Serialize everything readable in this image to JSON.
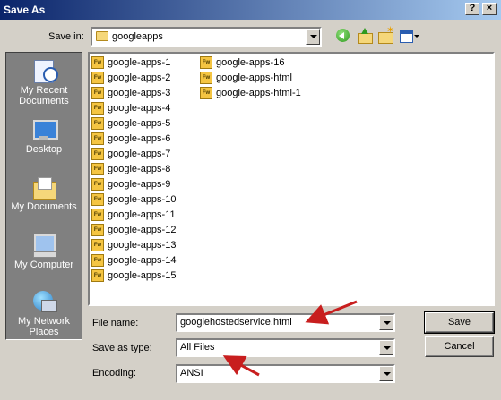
{
  "window": {
    "title": "Save As",
    "help_glyph": "?",
    "close_glyph": "×"
  },
  "toolbar": {
    "save_in_label": "Save in:",
    "save_in_value": "googleapps",
    "icons": [
      "back-icon",
      "up-folder-icon",
      "new-folder-icon",
      "views-menu-icon"
    ]
  },
  "places": [
    {
      "label": "My Recent Documents",
      "icon": "recent-documents-icon"
    },
    {
      "label": "Desktop",
      "icon": "desktop-icon"
    },
    {
      "label": "My Documents",
      "icon": "my-documents-icon"
    },
    {
      "label": "My Computer",
      "icon": "my-computer-icon"
    },
    {
      "label": "My Network Places",
      "icon": "network-places-icon"
    }
  ],
  "files": {
    "icon_text": "Fw",
    "column1": [
      "google-apps-1",
      "google-apps-2",
      "google-apps-3",
      "google-apps-4",
      "google-apps-5",
      "google-apps-6",
      "google-apps-7",
      "google-apps-8",
      "google-apps-9",
      "google-apps-10",
      "google-apps-11",
      "google-apps-12",
      "google-apps-13",
      "google-apps-14",
      "google-apps-15"
    ],
    "column2": [
      "google-apps-16",
      "google-apps-html",
      "google-apps-html-1"
    ]
  },
  "form": {
    "file_name_label": "File name:",
    "file_name_value": "googlehostedservice.html",
    "save_as_type_label": "Save as type:",
    "save_as_type_value": "All Files",
    "encoding_label": "Encoding:",
    "encoding_value": "ANSI"
  },
  "buttons": {
    "save": "Save",
    "cancel": "Cancel"
  },
  "annotation_color": "#c81e1e"
}
